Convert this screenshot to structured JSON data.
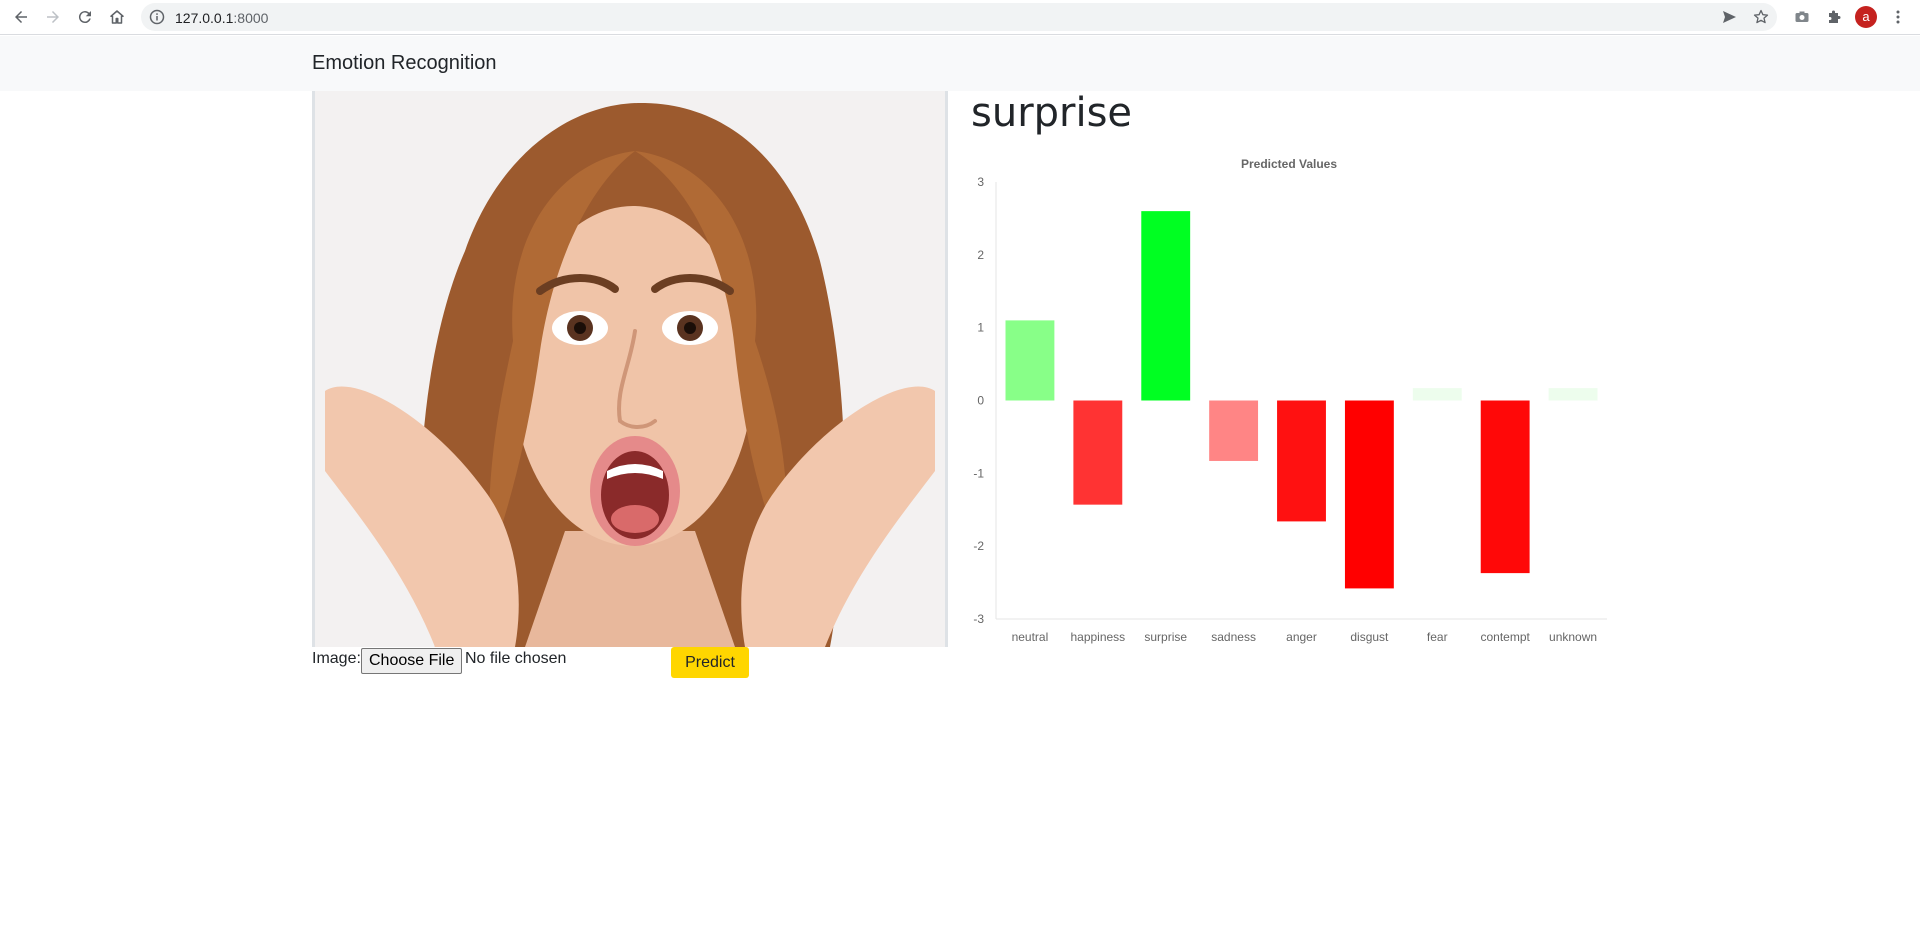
{
  "browser": {
    "url_host": "127.0.0.1",
    "url_port": ":8000",
    "profile_initial": "a"
  },
  "navbar": {
    "brand": "Emotion Recognition"
  },
  "form": {
    "image_label": "Image:",
    "choose_file_label": "Choose File",
    "file_status": "No file chosen",
    "predict_label": "Predict"
  },
  "result": {
    "predicted_emotion": "surprise"
  },
  "colors": {
    "predict_button": "#ffd600",
    "navbar_bg": "#f8f9fa"
  },
  "chart_data": {
    "type": "bar",
    "title": "Predicted Values",
    "categories": [
      "neutral",
      "happiness",
      "surprise",
      "sadness",
      "anger",
      "disgust",
      "fear",
      "contempt",
      "unknown"
    ],
    "values": [
      1.1,
      -1.43,
      2.6,
      -0.83,
      -1.66,
      -2.58,
      0.17,
      -2.37,
      0.17
    ],
    "colors": [
      "#88ff88",
      "#ff3333",
      "#00ff22",
      "#ff8585",
      "#ff1111",
      "#ff0000",
      "#edfded",
      "#ff0808",
      "#edfded"
    ],
    "ylim": [
      -3,
      3
    ],
    "yticks": [
      "3",
      "2",
      "1",
      "0",
      "-1",
      "-2",
      "-3"
    ],
    "grid": false,
    "legend": "none"
  }
}
